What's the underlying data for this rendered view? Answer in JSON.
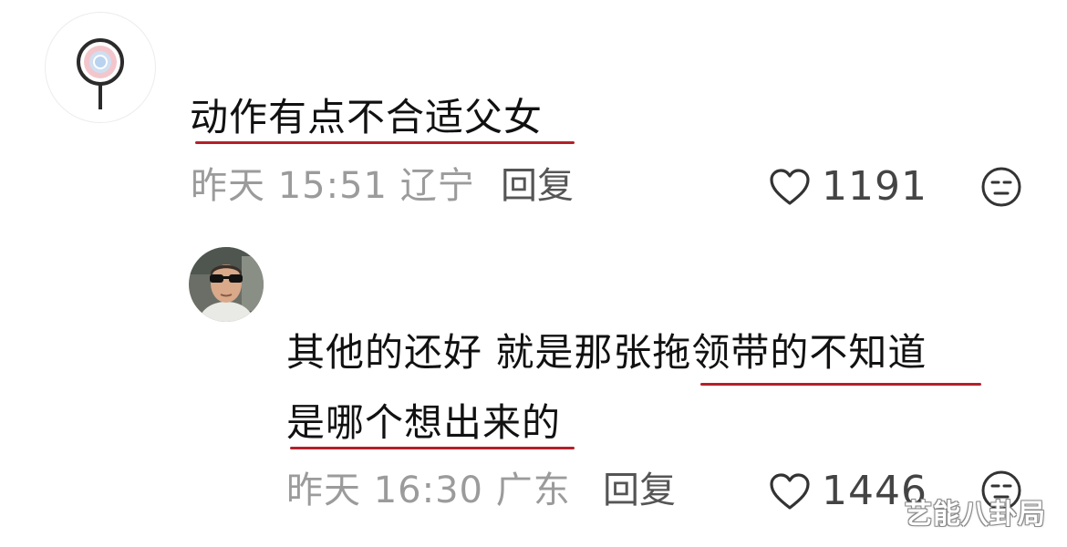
{
  "comments": [
    {
      "text_line1": "动作有点不合适父女",
      "time": "昨天 15:51",
      "location": "辽宁",
      "reply_label": "回复",
      "likes": "1191",
      "avatar_icon": "magnifier-lollipop-logo-icon",
      "liked": false
    },
    {
      "text_line1": "其他的还好 就是那张拖领带的不知道",
      "text_line2": "是哪个想出来的",
      "time": "昨天 16:30",
      "location": "广东",
      "reply_label": "回复",
      "likes": "1446",
      "avatar_icon": "man-sunglasses-photo",
      "liked": false
    }
  ],
  "watermark": "艺能八卦局",
  "colors": {
    "highlight_underline": "#b3202a",
    "meta_gray": "#9b9b9b",
    "text_dark": "#111111"
  }
}
